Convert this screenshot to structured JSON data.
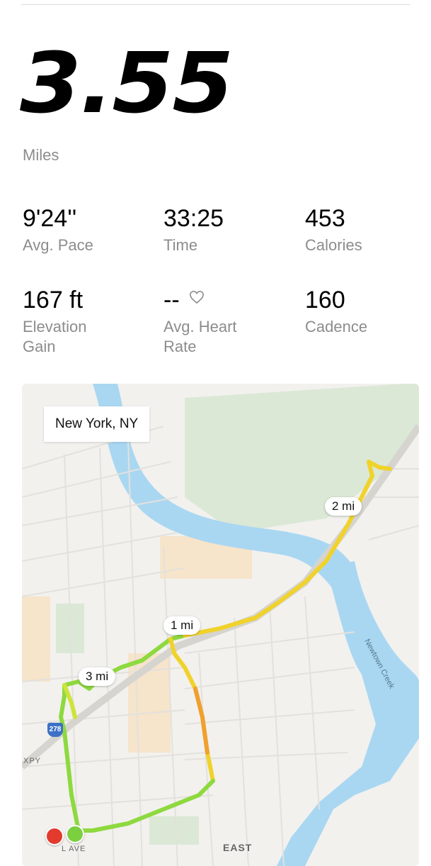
{
  "summary": {
    "distance": "3.55",
    "distance_unit": "Miles"
  },
  "stats": [
    {
      "value": "9'24''",
      "label": "Avg. Pace"
    },
    {
      "value": "33:25",
      "label": "Time"
    },
    {
      "value": "453",
      "label": "Calories"
    },
    {
      "value": "167 ft",
      "label": "Elevation\nGain"
    },
    {
      "value": "--",
      "label": "Avg. Heart\nRate",
      "icon": "heart-outline-icon"
    },
    {
      "value": "160",
      "label": "Cadence"
    }
  ],
  "map": {
    "location": "New York, NY",
    "mile_markers": [
      "1 mi",
      "2 mi",
      "3 mi"
    ],
    "highway_shield": "278",
    "street_labels": [
      "XPY",
      "L AVE",
      "EAST"
    ],
    "water_label": "Newtown Creek",
    "colors": {
      "land": "#f2f1ee",
      "park": "#dbe8d6",
      "water": "#a9d7f2",
      "route_fast": "#8ed93f",
      "route_slow": "#f0d22b",
      "route_slowest": "#f0a030",
      "start_marker": "#7ccf3e",
      "end_marker": "#e23b2e"
    }
  }
}
